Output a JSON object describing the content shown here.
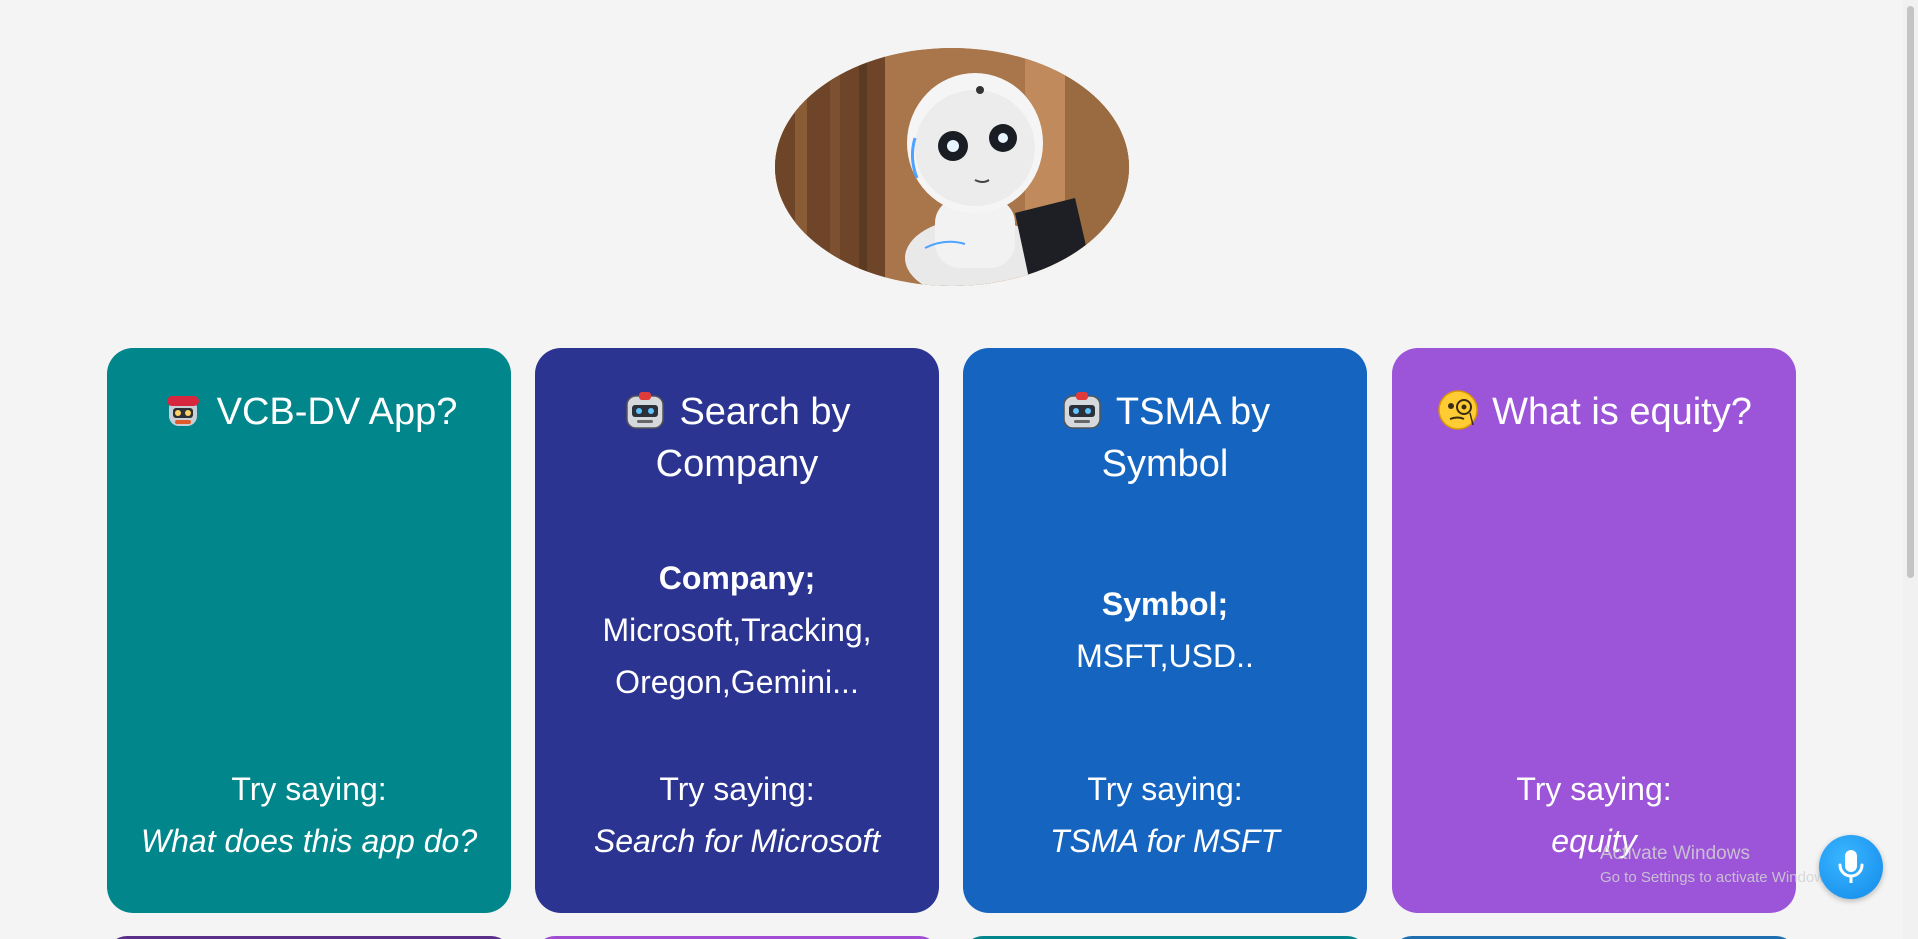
{
  "colors": {
    "background": "#f4f4f4",
    "card_teal": "#00868b",
    "card_indigo": "#2b3491",
    "card_blue": "#1565c0",
    "card_purple": "#9c54d9",
    "mic": "#1e97f0"
  },
  "hero": {
    "alt": "robot-photo"
  },
  "cards": [
    {
      "emoji": "robot-with-headband-icon",
      "title": "VCB-DV App?",
      "try_label": "Try saying:",
      "example": "What does this app do?"
    },
    {
      "emoji": "robot-face-icon",
      "title": "Search by Company",
      "detail_label": "Company;",
      "detail_text": "Microsoft,Tracking, Oregon,Gemini...",
      "try_label": "Try saying:",
      "example": "Search for Microsoft"
    },
    {
      "emoji": "robot-face-icon",
      "title": "TSMA by Symbol",
      "detail_label": "Symbol;",
      "detail_text": "MSFT,USD..",
      "try_label": "Try saying:",
      "example": "TSMA for MSFT"
    },
    {
      "emoji": "face-with-monocle-icon",
      "title": "What is equity?",
      "try_label": "Try saying:",
      "example": "equity"
    }
  ],
  "watermark": {
    "line1": "Activate Windows",
    "line2": "Go to Settings to activate Windows."
  },
  "mic_button": {
    "icon": "microphone-icon"
  }
}
